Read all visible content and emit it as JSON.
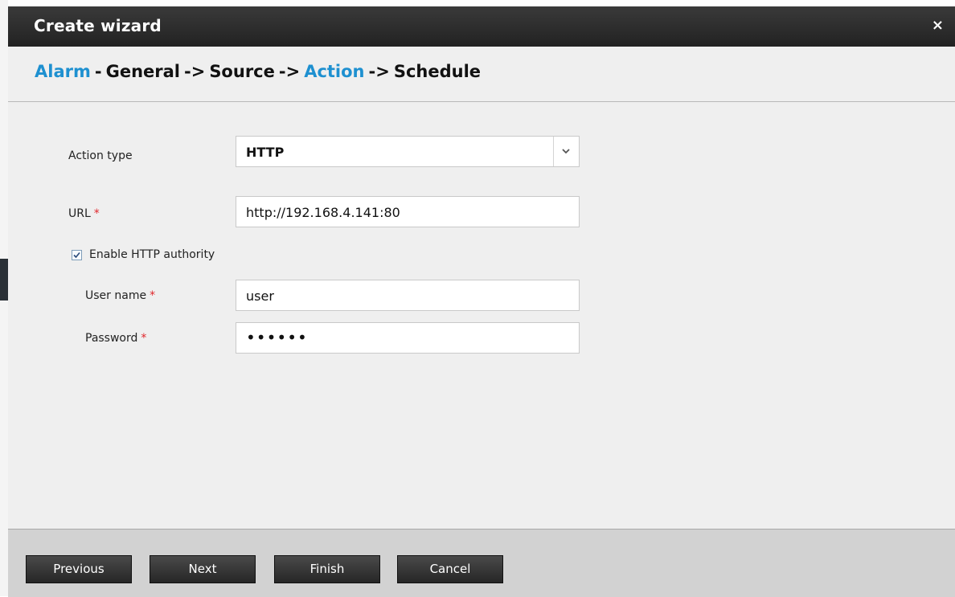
{
  "dialog": {
    "title": "Create wizard",
    "close_glyph": "×"
  },
  "breadcrumb": {
    "steps": [
      {
        "label": "Alarm",
        "active": true
      },
      {
        "sep": "-"
      },
      {
        "label": "General",
        "active": false
      },
      {
        "sep": "->"
      },
      {
        "label": "Source",
        "active": false
      },
      {
        "sep": "->"
      },
      {
        "label": "Action",
        "active": true
      },
      {
        "sep": "->"
      },
      {
        "label": "Schedule",
        "active": false
      }
    ]
  },
  "form": {
    "action_type": {
      "label": "Action type",
      "value": "HTTP"
    },
    "url": {
      "label": "URL",
      "required_mark": "*",
      "value": "http://192.168.4.141:80"
    },
    "enable_http_authority": {
      "label": "Enable HTTP authority",
      "checked": true
    },
    "user_name": {
      "label": "User name",
      "required_mark": "*",
      "value": "user"
    },
    "password": {
      "label": "Password",
      "required_mark": "*",
      "value": "••••••"
    }
  },
  "footer": {
    "previous": "Previous",
    "next": "Next",
    "finish": "Finish",
    "cancel": "Cancel"
  },
  "colors": {
    "accent_blue": "#1e90d0",
    "required_red": "#e0262b",
    "titlebar": "#2b2b2b",
    "button": "#333333"
  },
  "icons": {
    "close": "close-icon",
    "dropdown": "chevron-down-icon",
    "checkbox": "checkmark-icon"
  }
}
